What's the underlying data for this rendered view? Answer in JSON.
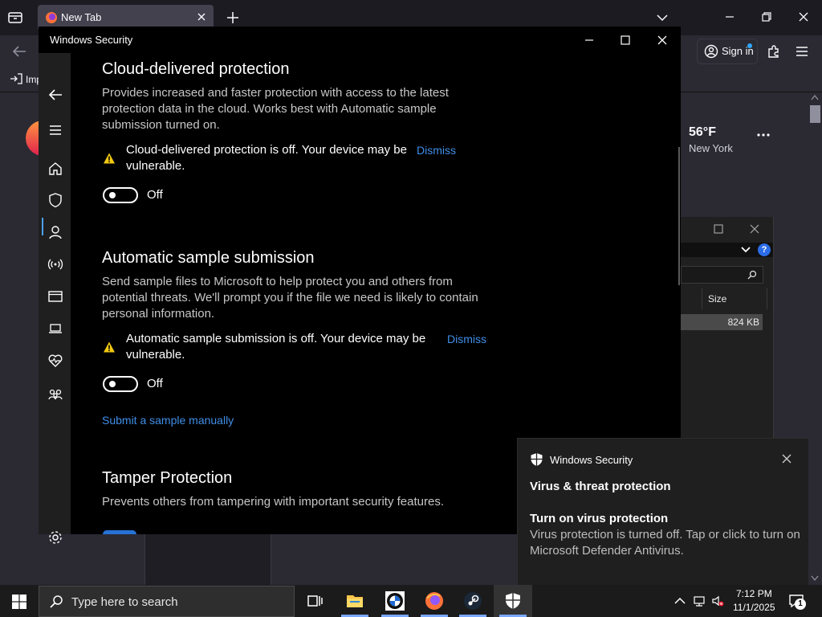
{
  "browser": {
    "tab_title": "New Tab",
    "signin_label": "Sign in",
    "bookmark_import": "Imp",
    "weather": {
      "temp": "56°F",
      "location": "New York"
    }
  },
  "explorer": {
    "column_size": "Size",
    "file_size": "824 KB",
    "help": "?"
  },
  "security_app": {
    "window_title": "Windows Security",
    "nav_items": [
      "back",
      "menu",
      "home",
      "virus-threat-protection",
      "account-protection",
      "firewall-network",
      "app-browser-control",
      "device-security",
      "device-performance-health",
      "family-options",
      "settings"
    ],
    "cloud": {
      "heading": "Cloud-delivered protection",
      "description": "Provides increased and faster protection with access to the latest protection data in the cloud. Works best with Automatic sample submission turned on.",
      "warning": "Cloud-delivered protection is off. Your device may be vulnerable.",
      "dismiss": "Dismiss",
      "toggle_state": "Off"
    },
    "sample": {
      "heading": "Automatic sample submission",
      "description": "Send sample files to Microsoft to help protect you and others from potential threats. We'll prompt you if the file we need is likely to contain personal information.",
      "warning": "Automatic sample submission is off. Your device may be vulnerable.",
      "dismiss": "Dismiss",
      "toggle_state": "Off",
      "manual_link": "Submit a sample manually"
    },
    "tamper": {
      "heading": "Tamper Protection",
      "description": "Prevents others from tampering with important security features."
    }
  },
  "toast": {
    "app_name": "Windows Security",
    "heading": "Virus & threat protection",
    "title": "Turn on virus protection",
    "body": "Virus protection is turned off. Tap or click to turn on Microsoft Defender Antivirus."
  },
  "taskbar": {
    "search_placeholder": "Type here to search",
    "pinned": [
      "task-view",
      "file-explorer",
      "bmw-app",
      "firefox",
      "steam",
      "windows-security"
    ],
    "time": "7:12 PM",
    "date": "11/1/2025",
    "notification_count": "1"
  },
  "colors": {
    "accent_link": "#3f8ee8",
    "warning": "#f2c811",
    "toggle_on": "#2672d6"
  }
}
